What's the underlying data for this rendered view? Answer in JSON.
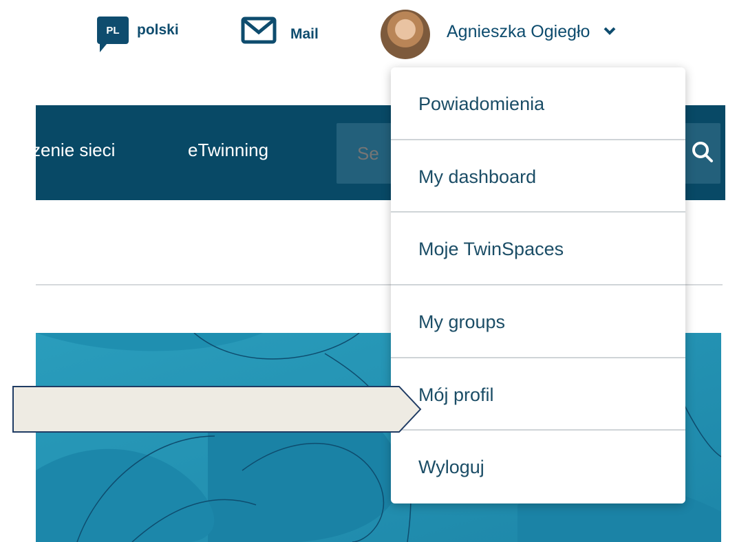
{
  "header": {
    "language_code": "PL",
    "language_label": "polski",
    "mail_label": "Mail",
    "user_name": "Agnieszka Ogiegło"
  },
  "navbar": {
    "items": [
      {
        "label": "zenie sieci"
      },
      {
        "label": "eTwinning"
      }
    ],
    "search_placeholder": "Se"
  },
  "dropdown": {
    "items": [
      {
        "label": "Powiadomienia"
      },
      {
        "label": "My dashboard"
      },
      {
        "label": "Moje TwinSpaces"
      },
      {
        "label": "My groups"
      },
      {
        "label": "Mój profil"
      },
      {
        "label": "Wyloguj"
      }
    ]
  },
  "colors": {
    "brand_dark": "#084966",
    "search_bg": "#23607b",
    "link": "#0e4c6e",
    "callout_fill": "#eeebe3",
    "callout_stroke": "#1f3b63"
  },
  "icons": {
    "language": "speech-bubble-icon",
    "mail": "envelope-icon",
    "user_menu": "chevron-down-icon",
    "search": "search-icon"
  }
}
